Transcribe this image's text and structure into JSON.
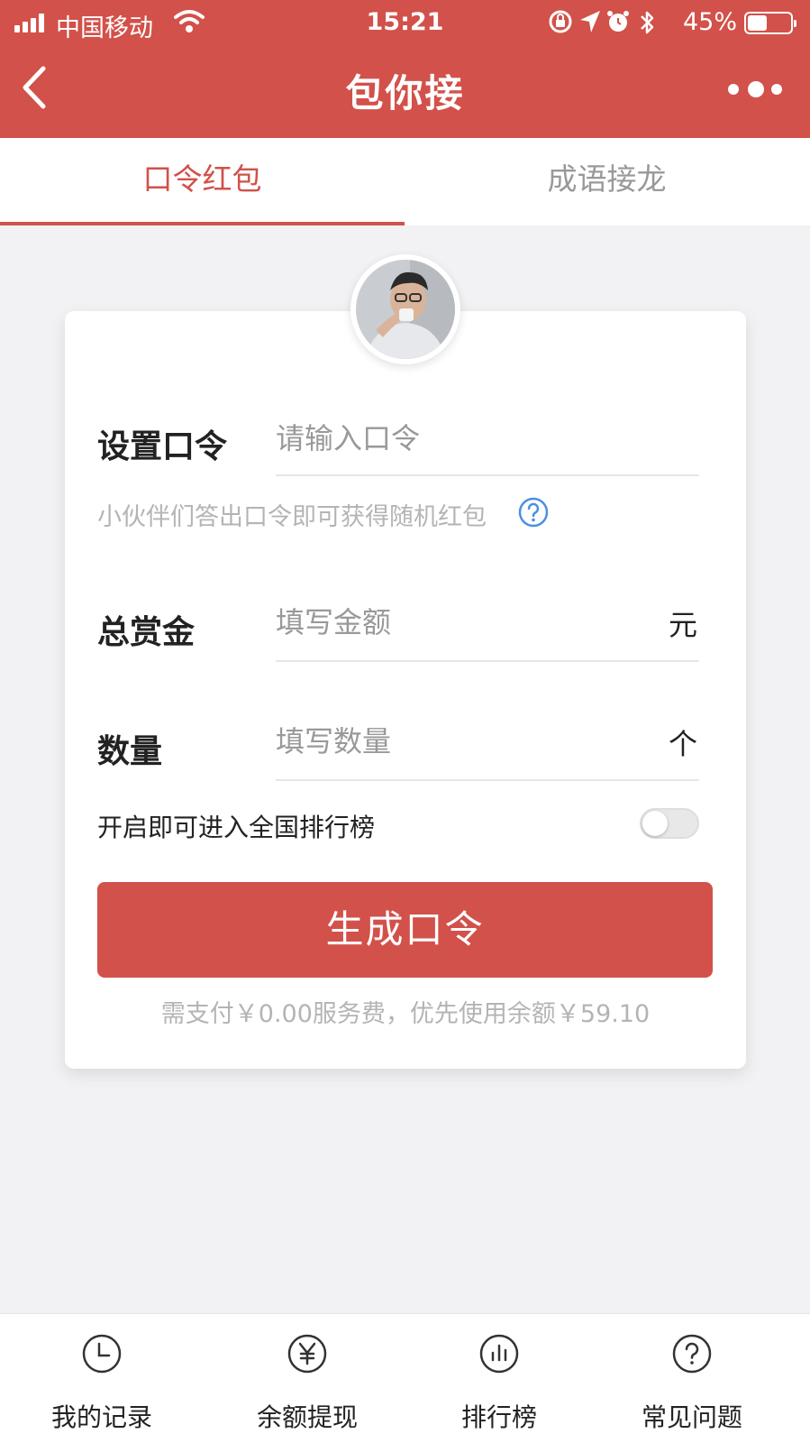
{
  "status_bar": {
    "carrier": "中国移动",
    "time": "15:21",
    "battery_percent": "45%",
    "battery_level": 0.45,
    "icons": [
      "signal-icon",
      "wifi-icon",
      "orientation-lock-icon",
      "location-arrow-icon",
      "alarm-icon",
      "bluetooth-icon",
      "battery-icon"
    ]
  },
  "nav": {
    "title": "包你接",
    "back_icon": "chevron-left-icon",
    "more_icon": "more-dots-icon"
  },
  "tabs": [
    {
      "label": "口令红包",
      "active": true
    },
    {
      "label": "成语接龙",
      "active": false
    }
  ],
  "form": {
    "password": {
      "label": "设置口令",
      "placeholder": "请输入口令",
      "value": ""
    },
    "hint": "小伙伴们答出口令即可获得随机红包",
    "total_reward": {
      "label": "总赏金",
      "placeholder": "填写金额",
      "value": "",
      "unit": "元"
    },
    "quantity": {
      "label": "数量",
      "placeholder": "填写数量",
      "value": "",
      "unit": "个"
    },
    "ranking_toggle": {
      "label": "开启即可进入全国排行榜",
      "on": false
    },
    "submit_label": "生成口令",
    "fee_text": "需支付￥0.00服务费，优先使用余额￥59.10"
  },
  "bottom_nav": [
    {
      "label": "我的记录",
      "icon": "clock-icon"
    },
    {
      "label": "余额提现",
      "icon": "yuan-icon"
    },
    {
      "label": "排行榜",
      "icon": "bar-chart-icon"
    },
    {
      "label": "常见问题",
      "icon": "question-icon"
    }
  ],
  "colors": {
    "brand_red": "#d2514a",
    "help_blue": "#4a90e2",
    "background": "#f2f2f4"
  }
}
